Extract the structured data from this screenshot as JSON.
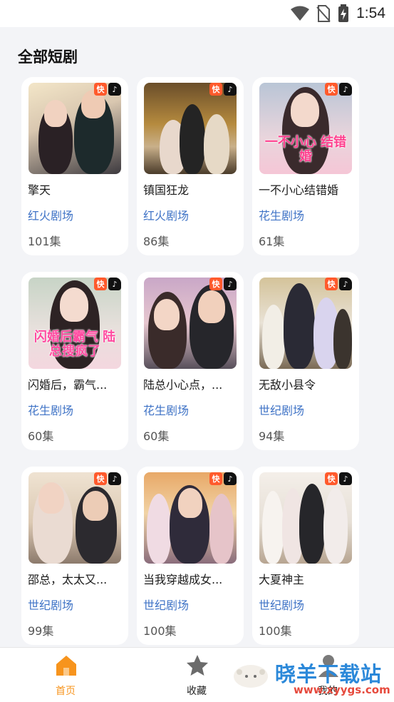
{
  "status_bar": {
    "time": "1:54"
  },
  "page": {
    "title": "全部短剧"
  },
  "dramas": [
    {
      "title": "擎天",
      "theater": "红火剧场",
      "episodes": "101集",
      "caption": ""
    },
    {
      "title": "镇国狂龙",
      "theater": "红火剧场",
      "episodes": "86集",
      "caption": ""
    },
    {
      "title": "一不小心结错婚",
      "theater": "花生剧场",
      "episodes": "61集",
      "caption": "一不小心 结错婚"
    },
    {
      "title": "闪婚后，霸气...",
      "theater": "花生剧场",
      "episodes": "60集",
      "caption": "闪婚后霸气 陆总搜疯了"
    },
    {
      "title": "陆总小心点，...",
      "theater": "花生剧场",
      "episodes": "60集",
      "caption": ""
    },
    {
      "title": "无敌小县令",
      "theater": "世纪剧场",
      "episodes": "94集",
      "caption": ""
    },
    {
      "title": "邵总，太太又...",
      "theater": "世纪剧场",
      "episodes": "99集",
      "caption": ""
    },
    {
      "title": "当我穿越成女...",
      "theater": "世纪剧场",
      "episodes": "100集",
      "caption": ""
    },
    {
      "title": "大夏神主",
      "theater": "世纪剧场",
      "episodes": "100集",
      "caption": ""
    }
  ],
  "badges": {
    "kuaishou": "快",
    "douyin": "♪"
  },
  "bottom_nav": {
    "items": [
      {
        "label": "首页",
        "icon": "home-icon",
        "active": true
      },
      {
        "label": "收藏",
        "icon": "star-icon",
        "active": false
      },
      {
        "label": "我的",
        "icon": "person-icon",
        "active": false
      }
    ]
  },
  "watermark": {
    "text": "晓羊下载站",
    "url": "www.xyygs.com"
  },
  "colors": {
    "accent": "#f7941d",
    "link": "#3f73c6",
    "background": "#f3f4f7"
  }
}
